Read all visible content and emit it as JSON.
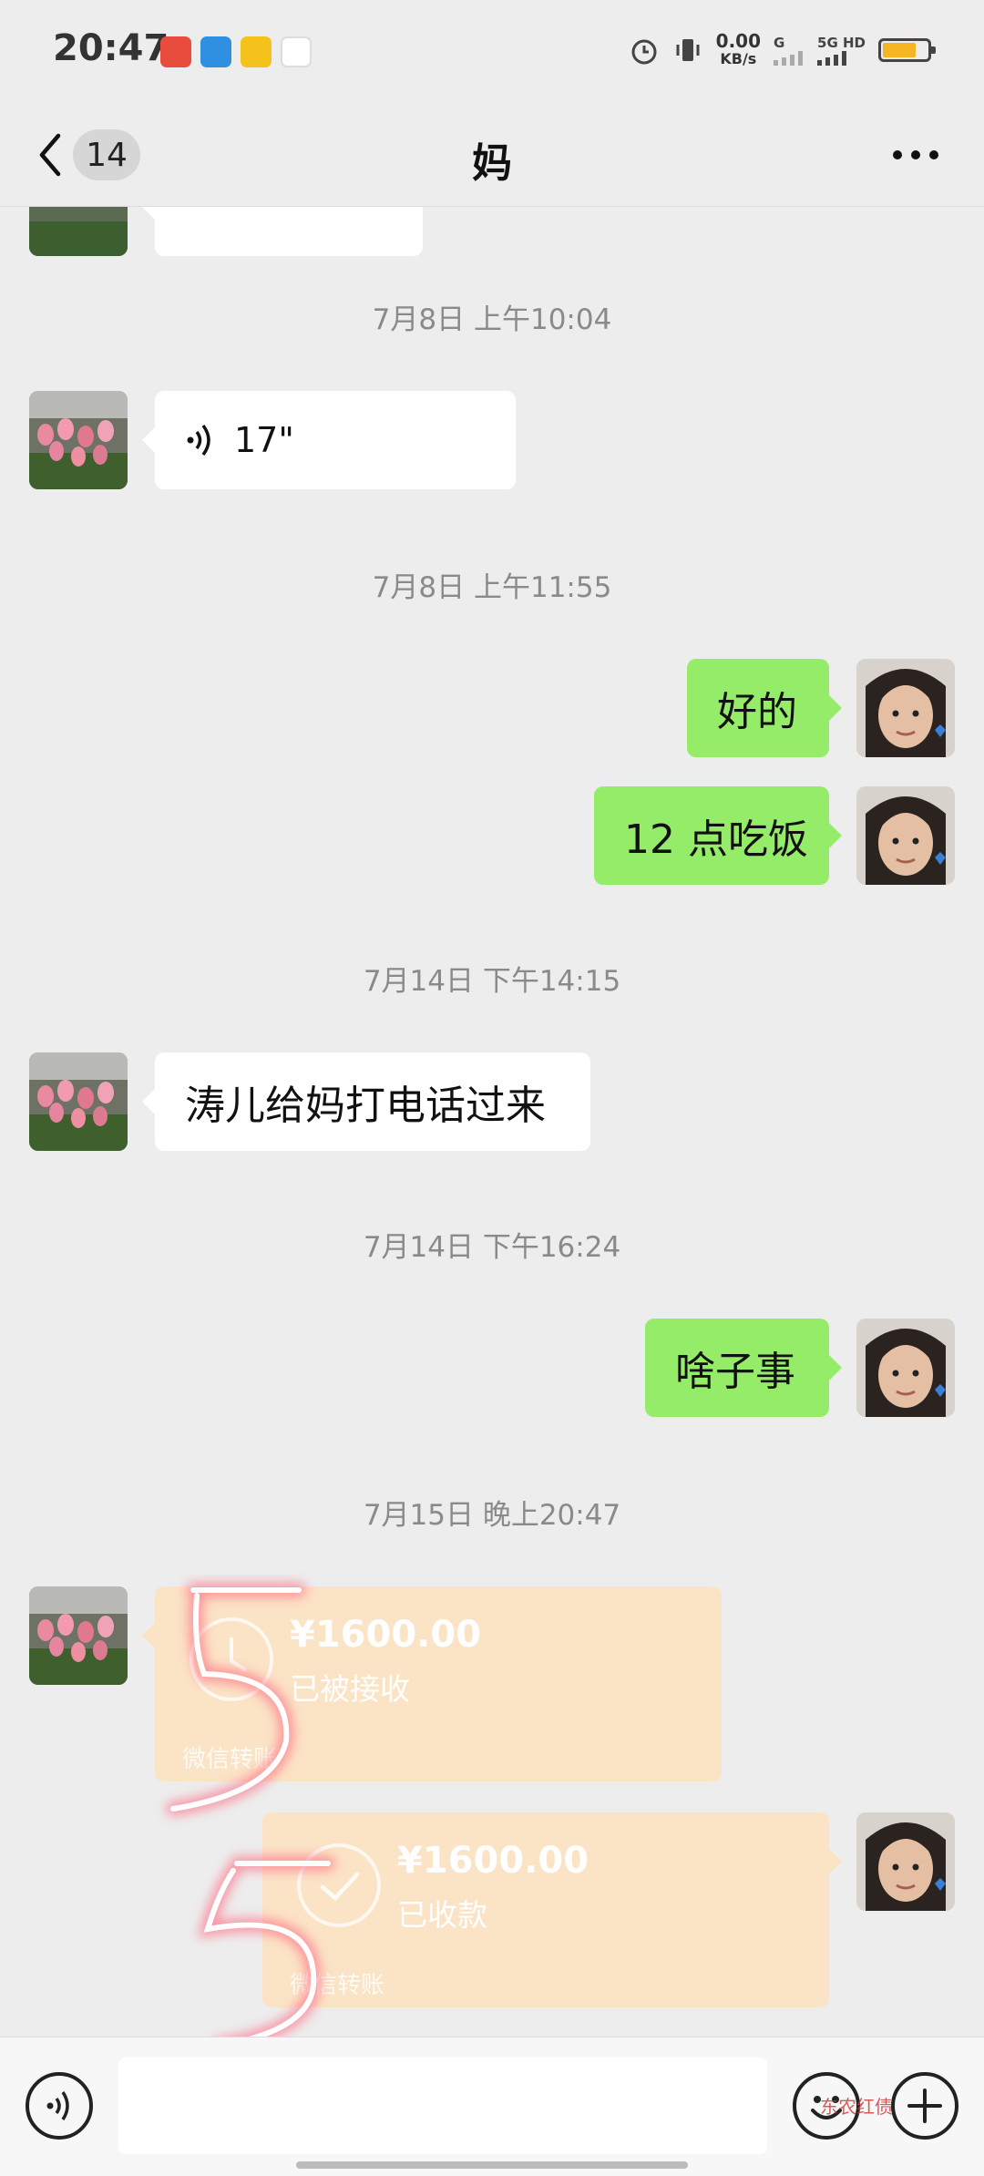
{
  "status_bar": {
    "time": "20:47",
    "net_speed_value": "0.00",
    "net_speed_unit": "KB/s",
    "network_a": "G",
    "network_b": "5G HD",
    "battery_level": 0.75
  },
  "header": {
    "back_count": "14",
    "title": "妈"
  },
  "messages": [
    {
      "type": "timestamp",
      "text": "7月8日 上午10:04"
    },
    {
      "type": "voice",
      "side": "in",
      "duration": "17\""
    },
    {
      "type": "timestamp",
      "text": "7月8日 上午11:55"
    },
    {
      "type": "text",
      "side": "out",
      "text": "好的"
    },
    {
      "type": "text",
      "side": "out",
      "text": "12 点吃饭"
    },
    {
      "type": "timestamp",
      "text": "7月14日 下午14:15"
    },
    {
      "type": "text",
      "side": "in",
      "text": "涛儿给妈打电话过来"
    },
    {
      "type": "timestamp",
      "text": "7月14日 下午16:24"
    },
    {
      "type": "text",
      "side": "out",
      "text": "啥子事"
    },
    {
      "type": "timestamp",
      "text": "7月15日 晚上20:47"
    },
    {
      "type": "transfer",
      "side": "in",
      "amount": "¥1600.00",
      "status": "已被接收",
      "footer": "微信转账"
    },
    {
      "type": "transfer",
      "side": "out",
      "amount": "¥1600.00",
      "status": "已收款",
      "footer": "微信转账"
    }
  ],
  "watermark": "东农红债",
  "colors": {
    "background": "#ededed",
    "bubble_out": "#95ec69",
    "bubble_in": "#ffffff",
    "transfer": "#fbe3c6",
    "scribble": "#e8495b"
  }
}
